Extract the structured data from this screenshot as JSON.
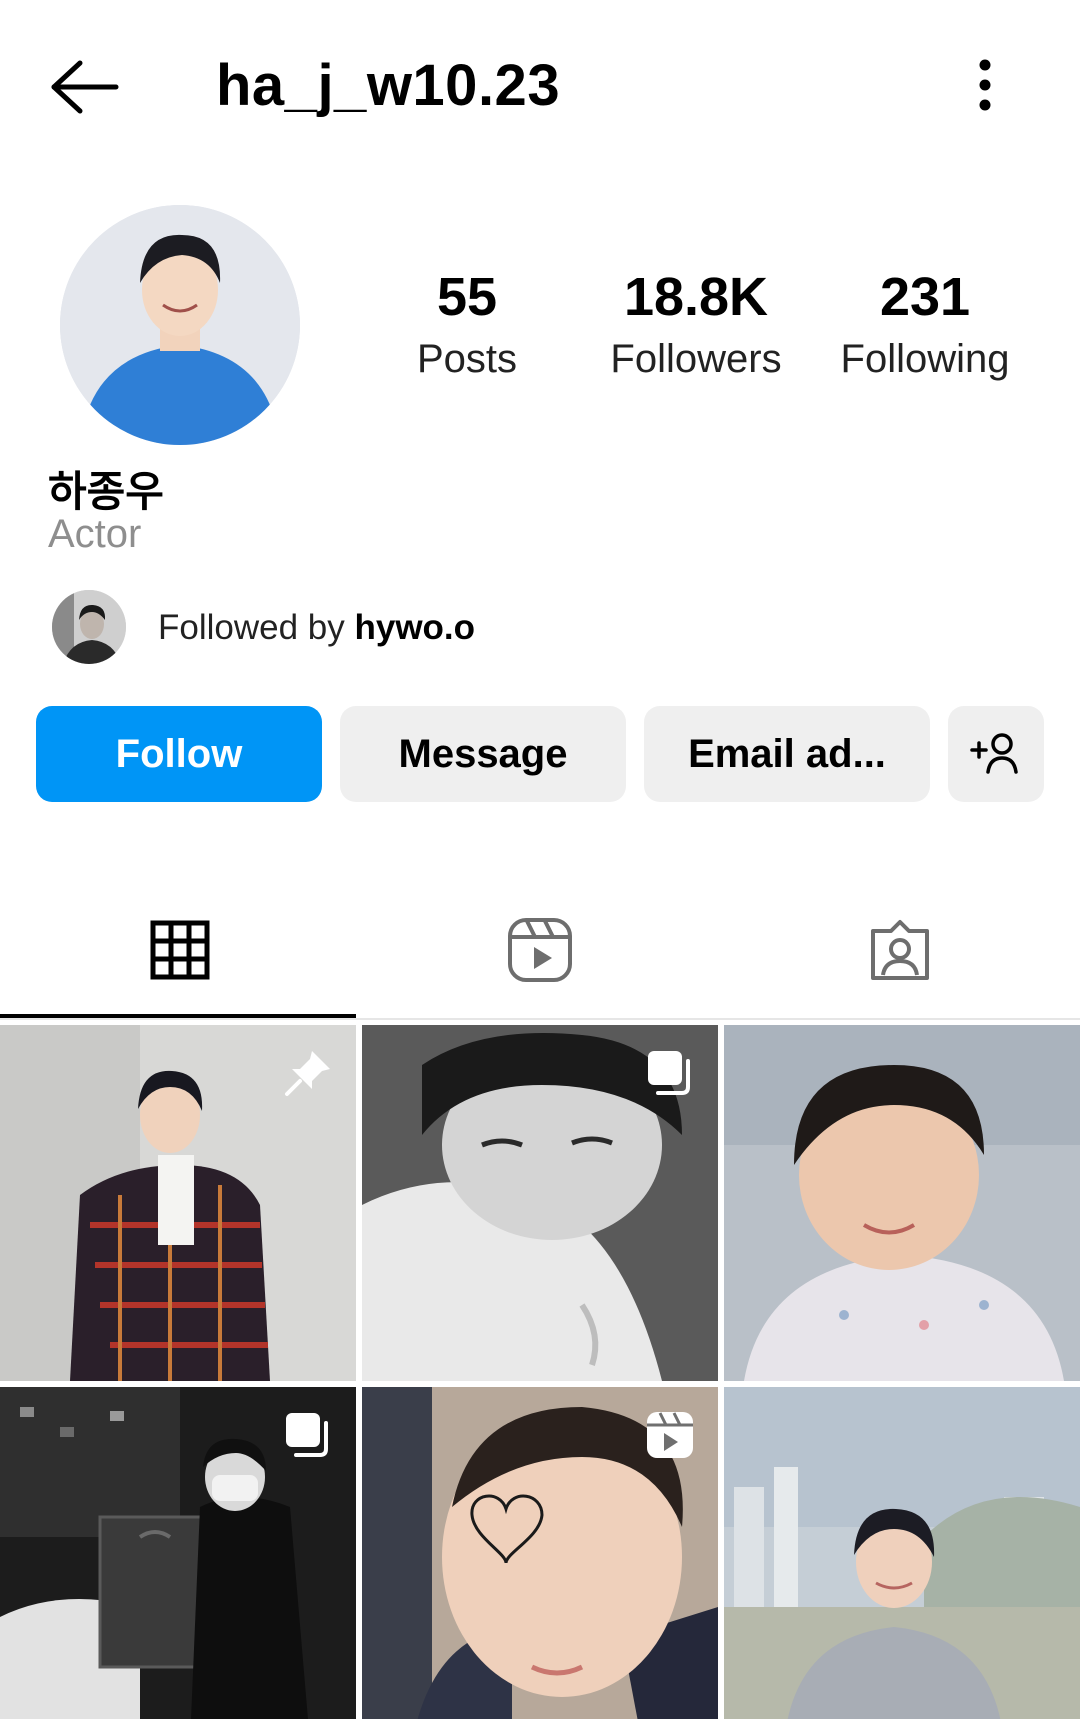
{
  "header": {
    "username": "ha_j_w10.23",
    "back_icon": "arrow-left-icon",
    "more_icon": "more-vertical-icon"
  },
  "profile": {
    "display_name": "하종우",
    "category": "Actor",
    "stats": {
      "posts": {
        "value": "55",
        "label": "Posts"
      },
      "followers": {
        "value": "18.8K",
        "label": "Followers"
      },
      "following": {
        "value": "231",
        "label": "Following"
      }
    },
    "followed_by": {
      "prefix": "Followed by ",
      "user": "hywo.o"
    }
  },
  "actions": {
    "follow": "Follow",
    "message": "Message",
    "email": "Email ad...",
    "add_user_icon": "add-person-icon"
  },
  "tabs": [
    {
      "icon": "grid-icon",
      "active": true
    },
    {
      "icon": "reels-icon",
      "active": false
    },
    {
      "icon": "tagged-icon",
      "active": false
    }
  ],
  "colors": {
    "accent": "#0095f6",
    "secondary_button": "#efefef",
    "muted_text": "#8e8e8e"
  },
  "posts": [
    {
      "badge": "pin-icon"
    },
    {
      "badge": "carousel-icon"
    },
    {
      "badge": ""
    },
    {
      "badge": "carousel-icon"
    },
    {
      "badge": "reel-icon"
    },
    {
      "badge": ""
    }
  ]
}
